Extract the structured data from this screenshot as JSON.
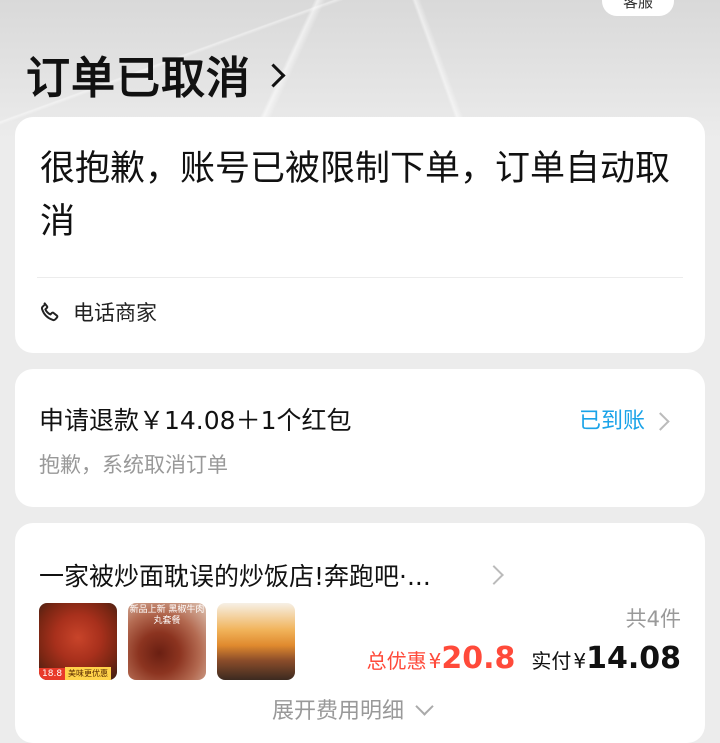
{
  "header": {
    "service_label": "客服",
    "title": "订单已取消"
  },
  "status_card": {
    "message": "很抱歉，账号已被限制下单，订单自动取消",
    "phone_label": "电话商家"
  },
  "refund_card": {
    "title": "申请退款￥14.08＋1个红包",
    "subtitle": "抱歉，系统取消订单",
    "status": "已到账",
    "status_color": "#1aa3e8"
  },
  "order_card": {
    "shop_name": "一家被炒面耽误的炒饭店!奔跑吧·...",
    "item_count": "共4件",
    "discount_label": "总优惠",
    "discount_currency": "¥",
    "discount_value": "20.8",
    "paid_label": "实付",
    "paid_currency": "¥",
    "paid_value": "14.08",
    "expand_label": "展开费用明细",
    "accent_color": "#ff4a3a",
    "thumbnails": [
      {
        "name": "food-thumbnail-noodles",
        "tag": "18.8",
        "tag2": "美味更优惠"
      },
      {
        "name": "food-thumbnail-meatballs",
        "overlay": "新品上新 黑椒牛肉丸套餐"
      },
      {
        "name": "food-thumbnail-cutlet"
      }
    ]
  }
}
